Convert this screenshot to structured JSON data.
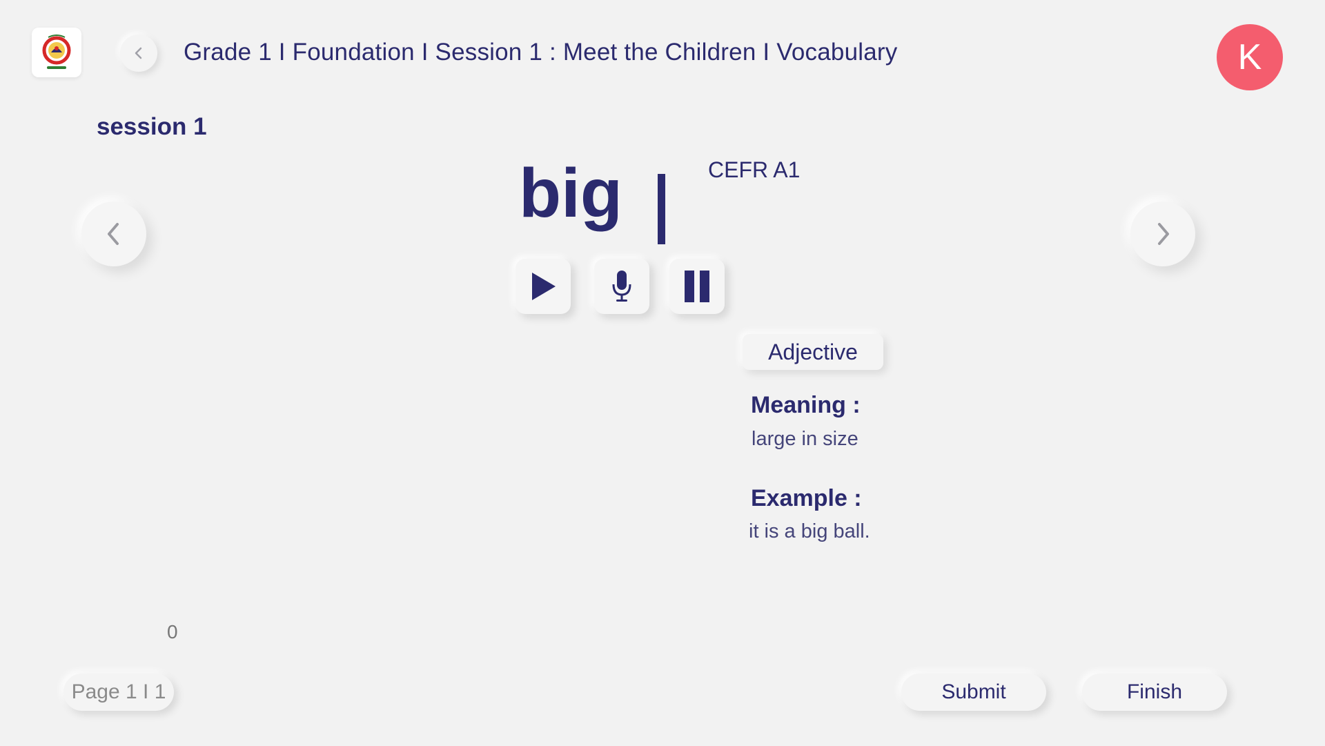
{
  "header": {
    "title": "Grade 1 I Foundation I Session 1 : Meet the Children I Vocabulary",
    "avatar_initial": "K",
    "logo_icon": "maharashtra-seal-logo",
    "back_icon": "chevron-left-icon"
  },
  "session": {
    "label": "session 1"
  },
  "word_card": {
    "word": "big",
    "cefr_level": "CEFR A1",
    "part_of_speech": "Adjective",
    "meaning_label": "Meaning :",
    "meaning_text": "large in size",
    "example_label": "Example :",
    "example_text": "it is a big ball.",
    "controls": [
      "play-icon",
      "microphone-icon",
      "pause-icon"
    ]
  },
  "navigation": {
    "prev_icon": "chevron-left-icon",
    "next_icon": "chevron-right-icon"
  },
  "footer": {
    "counter": "0",
    "page_label": "Page 1 I 1",
    "submit_label": "Submit",
    "finish_label": "Finish"
  },
  "colors": {
    "background": "#f2f2f2",
    "primary_text": "#2b2a6e",
    "avatar_bg": "#f45d6e"
  }
}
